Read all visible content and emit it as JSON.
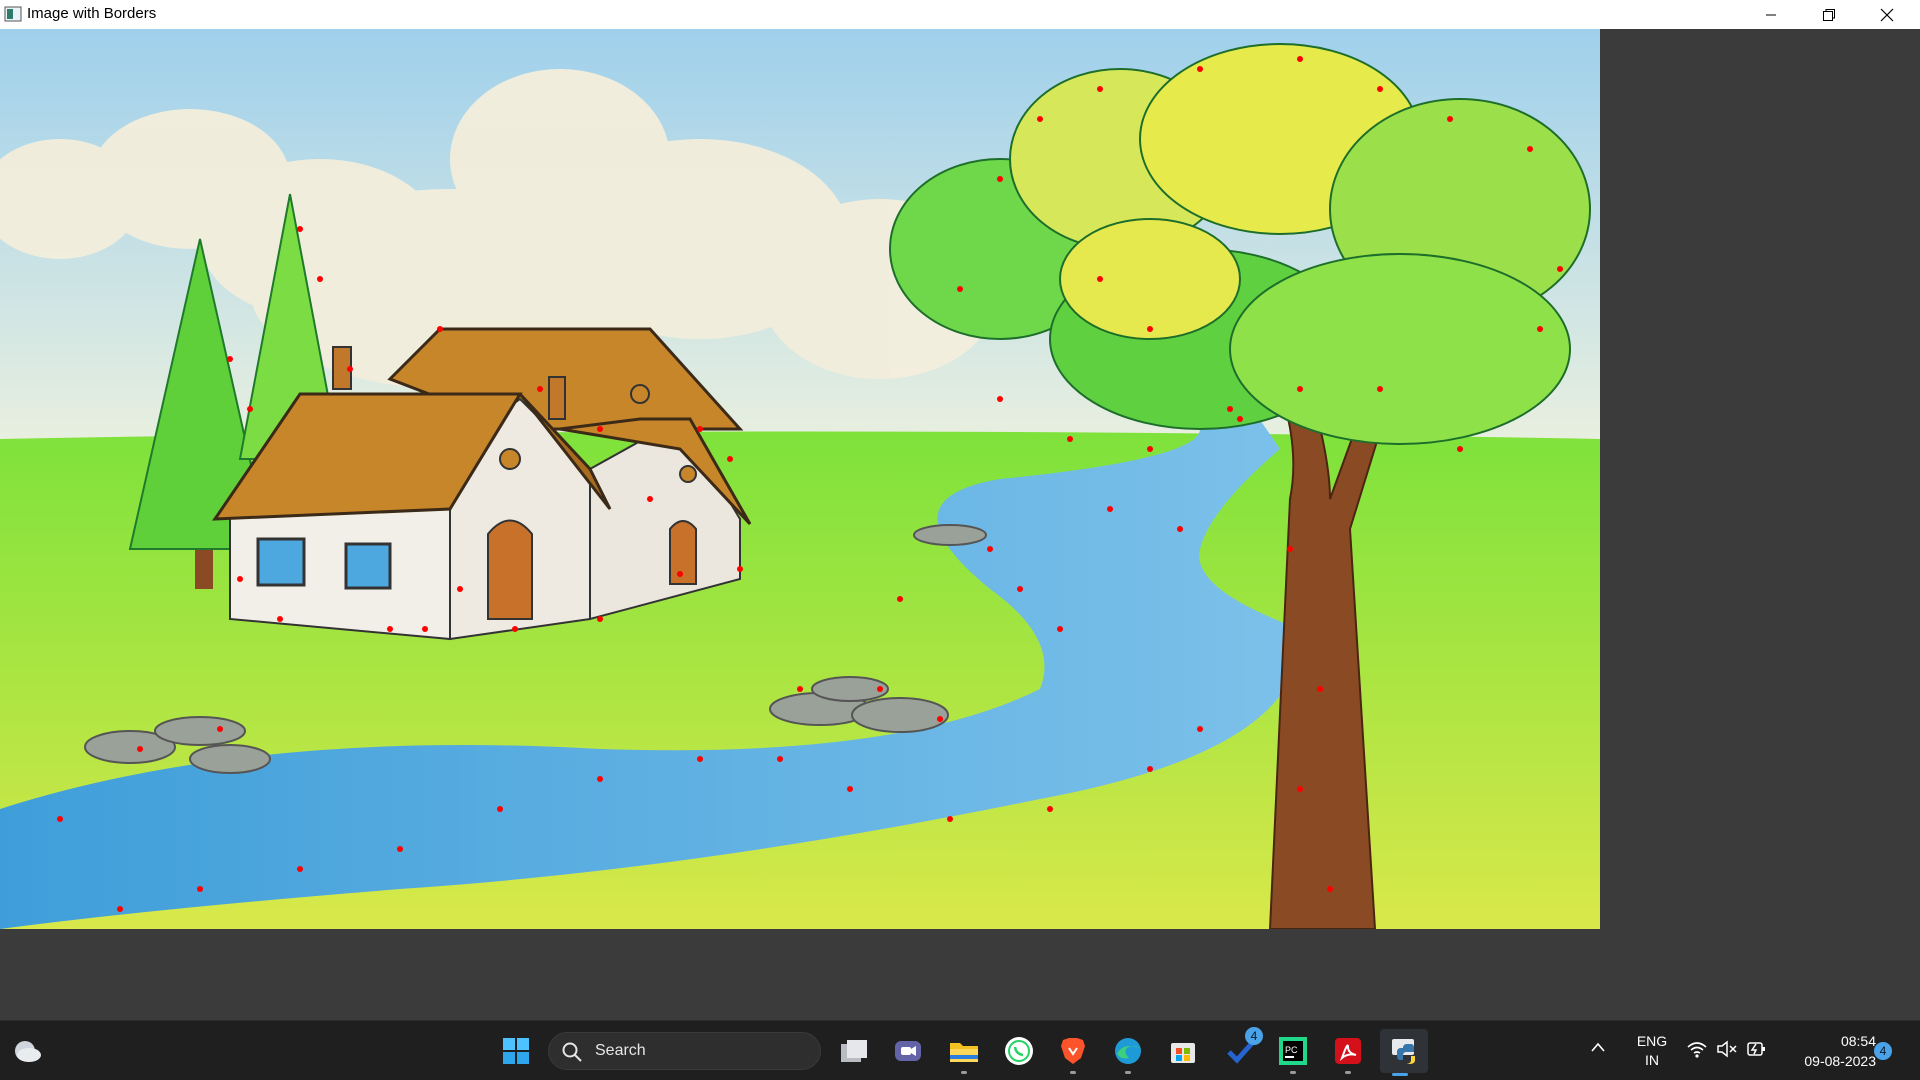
{
  "window": {
    "title": "Image with Borders",
    "controls": [
      "minimize-icon",
      "restore-icon",
      "close-icon"
    ]
  },
  "image": {
    "subject": "crayon drawing of a cottage, pine trees, a winding river and a large tree, with red corner-detection dots",
    "colors": {
      "sky": "#bfe0ef",
      "grass": "#c6e83a",
      "river": "#5aaee0",
      "roof": "#c8862a",
      "marker": "#ff0000"
    }
  },
  "taskbar": {
    "search": {
      "label": "Search"
    },
    "apps": [
      {
        "name": "task-view-icon"
      },
      {
        "name": "teams-chat-icon"
      },
      {
        "name": "file-explorer-icon"
      },
      {
        "name": "whatsapp-icon"
      },
      {
        "name": "brave-browser-icon"
      },
      {
        "name": "edge-browser-icon"
      },
      {
        "name": "microsoft-store-icon"
      },
      {
        "name": "todo-icon",
        "badge": "4"
      },
      {
        "name": "pycharm-icon"
      },
      {
        "name": "acrobat-icon"
      },
      {
        "name": "python-icon"
      }
    ],
    "tray": {
      "language_line1": "ENG",
      "language_line2": "IN",
      "time": "08:54",
      "date": "09-08-2023",
      "notification_count": "4"
    }
  }
}
